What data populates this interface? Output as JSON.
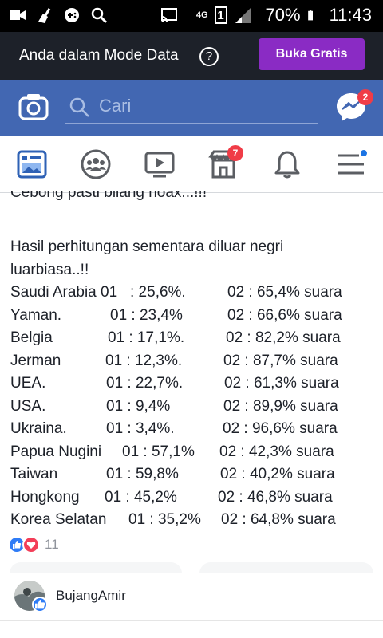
{
  "status_bar": {
    "network_label": "4G",
    "sim_label": "1",
    "battery_percent": "70%",
    "time": "11:43",
    "icons": [
      "video-camera-icon",
      "cleaner-icon",
      "game-controller-icon",
      "search-icon",
      "cast-icon",
      "signal-icon",
      "battery-icon"
    ]
  },
  "data_mode_bar": {
    "text": "Anda dalam Mode Data",
    "help_icon": "?",
    "button_label": "Buka Gratis"
  },
  "header": {
    "search_placeholder": "Cari",
    "messenger_badge": "2"
  },
  "nav": {
    "items": [
      "news-feed-icon",
      "groups-icon",
      "watch-icon",
      "marketplace-icon",
      "notifications-icon",
      "menu-icon"
    ],
    "marketplace_badge": "7"
  },
  "post": {
    "cut_line": "Cebong pasti bilang hoax...!!!",
    "intro_line1": "Hasil perhitungan sementara diluar negri",
    "intro_line2": "luarbiasa..!!",
    "rows": [
      {
        "country": "Saudi Arabia 01",
        "c01": " : 25,6%.",
        "c02": "02 :  65,4% suara"
      },
      {
        "country": "Yaman.",
        "c01": "01  : 23,4%",
        "c02": "02 :  66,6% suara"
      },
      {
        "country": "Belgia",
        "c01": "01  : 17,1%.",
        "c02": "02 :  82,2% suara"
      },
      {
        "country": "Jerman",
        "c01": "01  : 12,3%.",
        "c02": "02 :  87,7% suara"
      },
      {
        "country": "UEA.",
        "c01": "01  :  22,7%.",
        "c02": "02 : 61,3% suara"
      },
      {
        "country": "USA.",
        "c01": "01  :  9,4%",
        "c02": "02 : 89,9% suara"
      },
      {
        "country": "Ukraina.",
        "c01": "01  :  3,4%.",
        "c02": "02 : 96,6% suara"
      },
      {
        "country": "Papua Nugini",
        "c01": "01 :  57,1%",
        "c02": "02 : 42,3% suara"
      },
      {
        "country": "Taiwan",
        "c01": "01  :  59,8%",
        "c02": "02 : 40,2% suara"
      },
      {
        "country": "Hongkong",
        "c01": "01  :  45,2%",
        "c02": "02 : 46,8% suara"
      },
      {
        "country": "Korea Selatan",
        "c01": "01 : 35,2%",
        "c02": "02 : 64,8% suara"
      }
    ]
  },
  "reactions": {
    "count": "11"
  },
  "comment": {
    "author": "BujangAmir"
  },
  "colors": {
    "fb_blue": "#4267b2",
    "data_bar": "#1d2129",
    "button_purple": "#8a2bc4",
    "badge_red": "#f03c47"
  }
}
